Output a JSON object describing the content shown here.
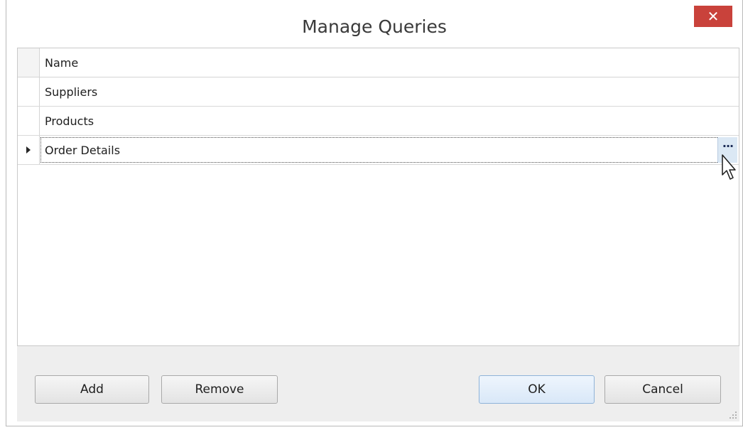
{
  "dialog": {
    "title": "Manage Queries",
    "close_glyph": "✕"
  },
  "grid": {
    "column_header": "Name",
    "rows": [
      {
        "name": "Suppliers"
      },
      {
        "name": "Products"
      },
      {
        "name": "Order Details",
        "selected": true
      }
    ],
    "ellipsis_label": "..."
  },
  "footer": {
    "add_label": "Add",
    "remove_label": "Remove",
    "ok_label": "OK",
    "cancel_label": "Cancel"
  },
  "colors": {
    "close_button": "#c9423b",
    "footer_background": "#eeeeee",
    "ok_button": "#d9e8f8"
  },
  "icons": {
    "row_indicator": "current-row-arrow-icon",
    "cursor": "mouse-pointer-icon",
    "resize": "resize-grip-icon"
  }
}
